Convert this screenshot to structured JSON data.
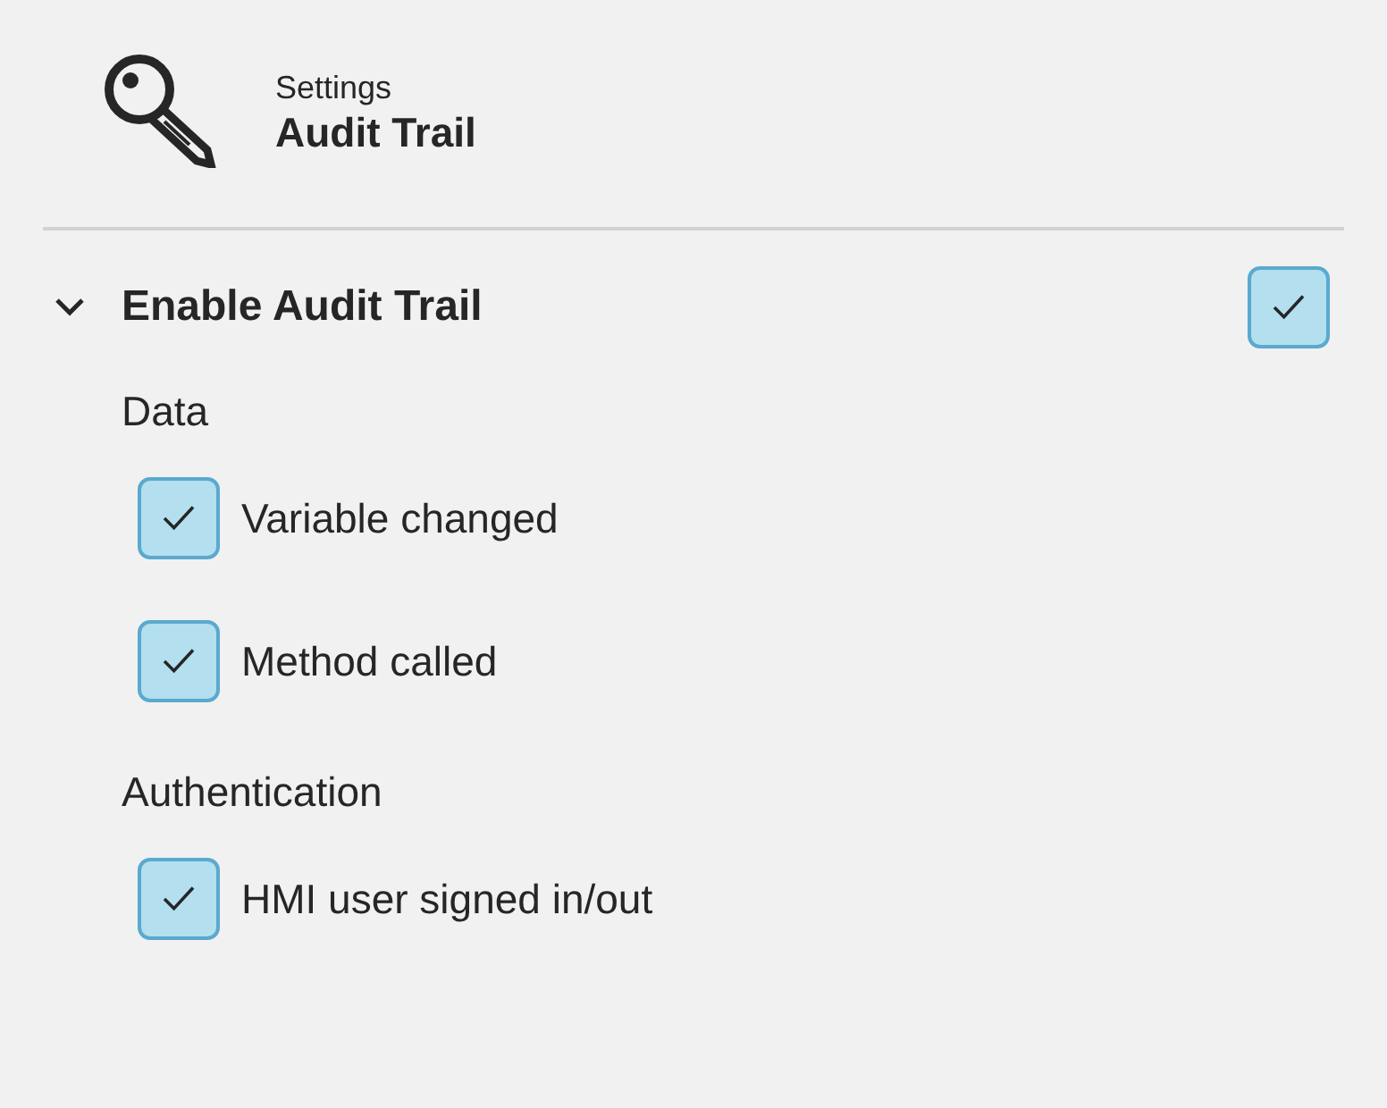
{
  "header": {
    "subtitle": "Settings",
    "title": "Audit Trail"
  },
  "section": {
    "label": "Enable Audit Trail",
    "expanded": true,
    "checked": true,
    "groups": [
      {
        "title": "Data",
        "items": [
          {
            "label": "Variable changed",
            "checked": true
          },
          {
            "label": "Method called",
            "checked": true
          }
        ]
      },
      {
        "title": "Authentication",
        "items": [
          {
            "label": "HMI user signed in/out",
            "checked": true
          }
        ]
      }
    ]
  }
}
